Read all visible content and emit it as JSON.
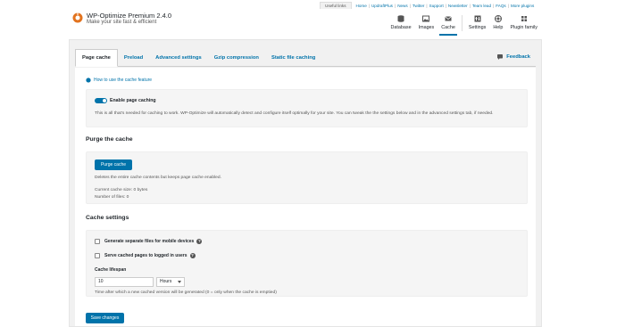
{
  "top_links": {
    "label": "Useful links",
    "items": [
      "Home",
      "UpdraftPlus",
      "News",
      "Twitter",
      "Support",
      "Newsletter",
      "Team lead",
      "FAQs",
      "More plugins"
    ]
  },
  "brand": {
    "title": "WP-Optimize Premium 2.4.0",
    "tagline": "Make your site fast & efficient"
  },
  "nav": {
    "items": [
      {
        "label": "Database",
        "icon": "database-icon"
      },
      {
        "label": "Images",
        "icon": "images-icon"
      },
      {
        "label": "Cache",
        "icon": "cache-icon",
        "active": true
      },
      {
        "label": "Settings",
        "icon": "settings-icon"
      },
      {
        "label": "Help",
        "icon": "help-icon"
      },
      {
        "label": "Plugin family",
        "icon": "plugin-family-icon"
      }
    ]
  },
  "tabs": {
    "items": [
      "Page cache",
      "Preload",
      "Advanced settings",
      "Gzip compression",
      "Static file caching"
    ],
    "active": "Page cache",
    "feedback": "Feedback"
  },
  "page_cache": {
    "how_to_link": "How to use the cache feature",
    "enable_label": "Enable page caching",
    "enable_on": true,
    "enable_desc": "This is all that's needed for caching to work. WP-Optimize will automatically detect and configure itself optimally for your site. You can tweak the the settings below and in the advanced settings tab, if needed."
  },
  "purge": {
    "title": "Purge the cache",
    "button": "Purge cache",
    "desc": "Deletes the entire cache contents but keeps page cache enabled.",
    "size_text": "Current cache size: 0 bytes",
    "files_text": "Number of files: 0"
  },
  "cache_settings": {
    "title": "Cache settings",
    "mobile_label": "Generate separate files for mobile devices",
    "mobile_checked": false,
    "logged_in_label": "Serve cached pages to logged in users",
    "logged_in_checked": false,
    "lifespan_label": "Cache lifespan",
    "lifespan_value": "10",
    "lifespan_unit": "Hours",
    "lifespan_help": "Time after which a new cached version will be generated (0 = only when the cache is emptied)"
  },
  "save_button": "Save changes",
  "colors": {
    "accent": "#0073aa",
    "logo": "#e2731f",
    "panel_bg": "#f5f5f5",
    "page_bg": "#f1f1f1"
  }
}
